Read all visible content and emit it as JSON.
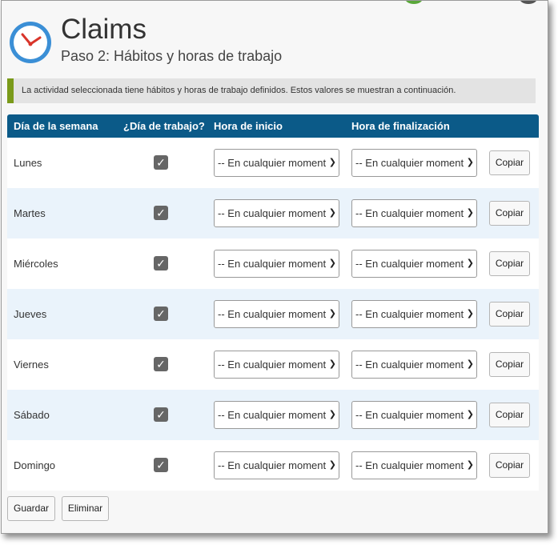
{
  "header": {
    "title": "Claims",
    "subtitle": "Paso 2: Hábitos y horas de trabajo",
    "icon": "clock-icon"
  },
  "info": {
    "message": "La actividad seleccionada tiene hábitos y horas de trabajo definidos. Estos valores se muestran a continuación."
  },
  "table": {
    "headers": {
      "day": "Día de la semana",
      "workday": "¿Día de trabajo?",
      "start": "Hora de inicio",
      "end": "Hora de finalización"
    },
    "rows": [
      {
        "day": "Lunes",
        "workday": true,
        "start": "-- En cualquier moment",
        "end": "-- En cualquier moment",
        "copy": "Copiar"
      },
      {
        "day": "Martes",
        "workday": true,
        "start": "-- En cualquier moment",
        "end": "-- En cualquier moment",
        "copy": "Copiar"
      },
      {
        "day": "Miércoles",
        "workday": true,
        "start": "-- En cualquier moment",
        "end": "-- En cualquier moment",
        "copy": "Copiar"
      },
      {
        "day": "Jueves",
        "workday": true,
        "start": "-- En cualquier moment",
        "end": "-- En cualquier moment",
        "copy": "Copiar"
      },
      {
        "day": "Viernes",
        "workday": true,
        "start": "-- En cualquier moment",
        "end": "-- En cualquier moment",
        "copy": "Copiar"
      },
      {
        "day": "Sábado",
        "workday": true,
        "start": "-- En cualquier moment",
        "end": "-- En cualquier moment",
        "copy": "Copiar"
      },
      {
        "day": "Domingo",
        "workday": true,
        "start": "-- En cualquier moment",
        "end": "-- En cualquier moment",
        "copy": "Copiar"
      }
    ]
  },
  "footer": {
    "save_label": "Guardar",
    "delete_label": "Eliminar"
  },
  "colors": {
    "header_bg": "#0b5a88",
    "info_accent": "#7a9a1a",
    "row_alt": "#eaf3fb"
  }
}
